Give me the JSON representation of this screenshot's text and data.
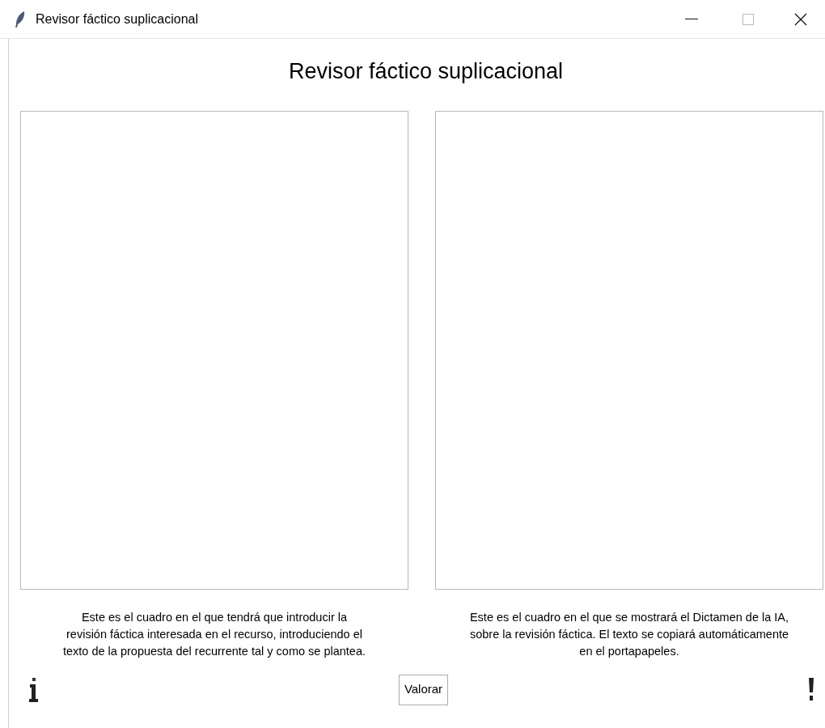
{
  "window": {
    "title": "Revisor fáctico suplicacional"
  },
  "heading": "Revisor fáctico suplicacional",
  "panels": [
    {
      "caption_lines": [
        "Este es el cuadro en el que tendrá que introducir la",
        "revisión fáctica interesada en el recurso, introduciendo el",
        "texto de la propuesta del recurrente tal y como se plantea."
      ]
    },
    {
      "caption_lines": [
        "Este es el cuadro en el que se mostrará el Dictamen de la IA,",
        "sobre la revisión fáctica. El texto se copiará automáticamente",
        "en el portapapeles."
      ]
    }
  ],
  "button": "Valorar"
}
